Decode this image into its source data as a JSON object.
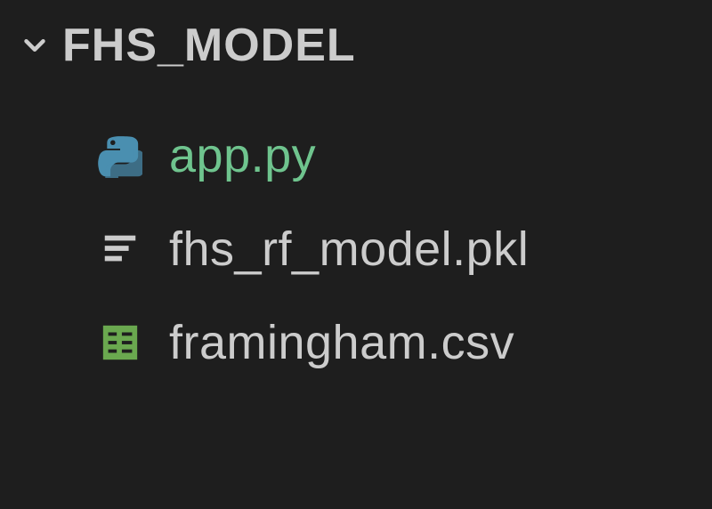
{
  "explorer": {
    "folder_name": "FHS_MODEL",
    "expanded": true,
    "files": [
      {
        "name": "app.py",
        "type": "python",
        "icon": "python-icon"
      },
      {
        "name": "fhs_rf_model.pkl",
        "type": "binary",
        "icon": "lines-icon"
      },
      {
        "name": "framingham.csv",
        "type": "csv",
        "icon": "csv-icon"
      }
    ]
  }
}
